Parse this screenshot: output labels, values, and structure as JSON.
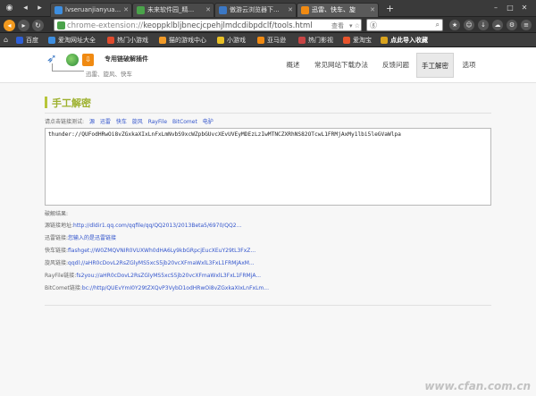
{
  "browser": {
    "tabs": [
      {
        "label": "lvseruanjianyua..."
      },
      {
        "label": "未来软件园_精..."
      },
      {
        "label": "傲游云浏览器下..."
      },
      {
        "label": "迅雷、快车、旋"
      }
    ],
    "new_tab": "+",
    "url": {
      "prefix": "chrome-extension://",
      "path": "keoppklbljbnecjcpehjlmdcdibpdclf/tools.html",
      "right_label": "查看",
      "more": "▾ ☆"
    },
    "bookmarks": [
      {
        "label": "百度",
        "color": "#2e5fd6"
      },
      {
        "label": "爱淘网址大全",
        "color": "#3d8ee0"
      },
      {
        "label": "热门小游戏",
        "color": "#e04b2d"
      },
      {
        "label": "猫的游戏中心",
        "color": "#f19a27"
      },
      {
        "label": "小游戏",
        "color": "#e9c025"
      },
      {
        "label": "亚马逊",
        "color": "#f08a12"
      },
      {
        "label": "热门影视",
        "color": "#c84545"
      },
      {
        "label": "爱淘宝",
        "color": "#e8542c"
      },
      {
        "label": "点此导入收藏",
        "color": "#d9a31d"
      }
    ]
  },
  "header": {
    "title": "专用链破解插件",
    "subtitle": "迅雷、旋风、快车",
    "menu": [
      {
        "label": "概述"
      },
      {
        "label": "常见网站下载办法"
      },
      {
        "label": "反馈问题"
      },
      {
        "label": "手工解密"
      },
      {
        "label": "选项"
      }
    ]
  },
  "section": {
    "title": "手工解密",
    "test_label": "请点击链接测试:",
    "test_links": [
      "源",
      "迅雷",
      "快车",
      "旋风",
      "RayFile",
      "BitComet",
      "电驴"
    ],
    "input_value": "thunder://QUFodHRwOi8vZGxkaXIxLnFxLmNvbS9xcWZpbGUvcXEvUVEyMDEzLzIwMTNCZXRhNS82OTcwL1FRMjAxMy1lbi5leGVaWlpa",
    "result_label": "破解结果:",
    "results": [
      {
        "label": "源链接地址:",
        "value": "http://dldir1.qq.com/qqfile/qq/QQ2013/2013Beta5/6970/QQ2..."
      },
      {
        "label": "迅雷链接:",
        "value": "您输入的是迅雷链接"
      },
      {
        "label": "快车链接:",
        "value": "flashget://W0ZMQVNIR0VUXWh0dHA6Ly9kbGRpcjEucXEuY29tL3FxZ..."
      },
      {
        "label": "旋风链接:",
        "value": "qqdl://aHR0cDovL2RsZGlyMS5xcS5jb20vcXFmaWxlL3FxL1FRMjAxM..."
      },
      {
        "label": "RayFile链接:",
        "value": "fs2you://aHR0cDovL2RsZGlyMS5xcS5jb20vcXFmaWxlL3FxL1FRMjA..."
      },
      {
        "label": "BitComet链接:",
        "value": "bc://http/QUEvYmI0Y29tZXQvP3VybD1odHRwOi8vZGxkaXIxLnFxLm..."
      }
    ]
  },
  "watermark": "www.cfan.com.cn"
}
